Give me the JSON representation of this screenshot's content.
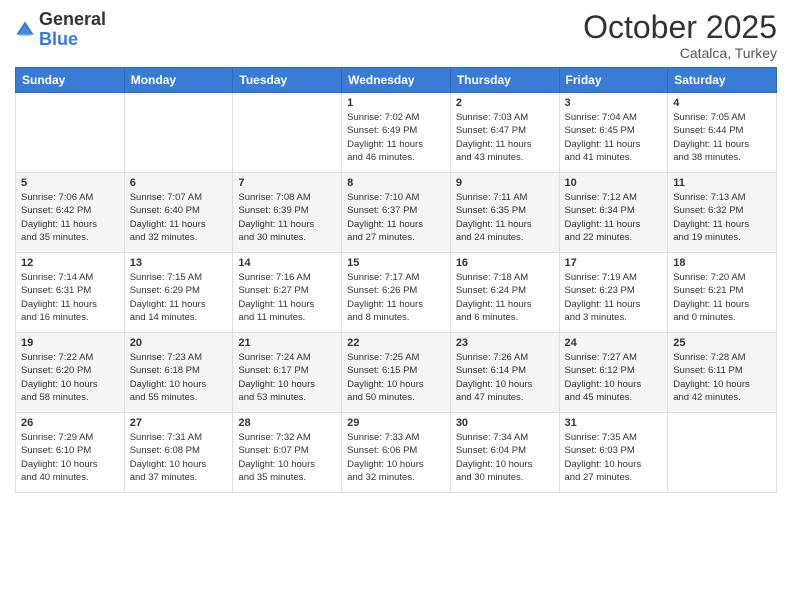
{
  "logo": {
    "text_general": "General",
    "text_blue": "Blue"
  },
  "header": {
    "month": "October 2025",
    "location": "Catalca, Turkey"
  },
  "weekdays": [
    "Sunday",
    "Monday",
    "Tuesday",
    "Wednesday",
    "Thursday",
    "Friday",
    "Saturday"
  ],
  "weeks": [
    [
      {
        "day": "",
        "info": ""
      },
      {
        "day": "",
        "info": ""
      },
      {
        "day": "",
        "info": ""
      },
      {
        "day": "1",
        "info": "Sunrise: 7:02 AM\nSunset: 6:49 PM\nDaylight: 11 hours\nand 46 minutes."
      },
      {
        "day": "2",
        "info": "Sunrise: 7:03 AM\nSunset: 6:47 PM\nDaylight: 11 hours\nand 43 minutes."
      },
      {
        "day": "3",
        "info": "Sunrise: 7:04 AM\nSunset: 6:45 PM\nDaylight: 11 hours\nand 41 minutes."
      },
      {
        "day": "4",
        "info": "Sunrise: 7:05 AM\nSunset: 6:44 PM\nDaylight: 11 hours\nand 38 minutes."
      }
    ],
    [
      {
        "day": "5",
        "info": "Sunrise: 7:06 AM\nSunset: 6:42 PM\nDaylight: 11 hours\nand 35 minutes."
      },
      {
        "day": "6",
        "info": "Sunrise: 7:07 AM\nSunset: 6:40 PM\nDaylight: 11 hours\nand 32 minutes."
      },
      {
        "day": "7",
        "info": "Sunrise: 7:08 AM\nSunset: 6:39 PM\nDaylight: 11 hours\nand 30 minutes."
      },
      {
        "day": "8",
        "info": "Sunrise: 7:10 AM\nSunset: 6:37 PM\nDaylight: 11 hours\nand 27 minutes."
      },
      {
        "day": "9",
        "info": "Sunrise: 7:11 AM\nSunset: 6:35 PM\nDaylight: 11 hours\nand 24 minutes."
      },
      {
        "day": "10",
        "info": "Sunrise: 7:12 AM\nSunset: 6:34 PM\nDaylight: 11 hours\nand 22 minutes."
      },
      {
        "day": "11",
        "info": "Sunrise: 7:13 AM\nSunset: 6:32 PM\nDaylight: 11 hours\nand 19 minutes."
      }
    ],
    [
      {
        "day": "12",
        "info": "Sunrise: 7:14 AM\nSunset: 6:31 PM\nDaylight: 11 hours\nand 16 minutes."
      },
      {
        "day": "13",
        "info": "Sunrise: 7:15 AM\nSunset: 6:29 PM\nDaylight: 11 hours\nand 14 minutes."
      },
      {
        "day": "14",
        "info": "Sunrise: 7:16 AM\nSunset: 6:27 PM\nDaylight: 11 hours\nand 11 minutes."
      },
      {
        "day": "15",
        "info": "Sunrise: 7:17 AM\nSunset: 6:26 PM\nDaylight: 11 hours\nand 8 minutes."
      },
      {
        "day": "16",
        "info": "Sunrise: 7:18 AM\nSunset: 6:24 PM\nDaylight: 11 hours\nand 6 minutes."
      },
      {
        "day": "17",
        "info": "Sunrise: 7:19 AM\nSunset: 6:23 PM\nDaylight: 11 hours\nand 3 minutes."
      },
      {
        "day": "18",
        "info": "Sunrise: 7:20 AM\nSunset: 6:21 PM\nDaylight: 11 hours\nand 0 minutes."
      }
    ],
    [
      {
        "day": "19",
        "info": "Sunrise: 7:22 AM\nSunset: 6:20 PM\nDaylight: 10 hours\nand 58 minutes."
      },
      {
        "day": "20",
        "info": "Sunrise: 7:23 AM\nSunset: 6:18 PM\nDaylight: 10 hours\nand 55 minutes."
      },
      {
        "day": "21",
        "info": "Sunrise: 7:24 AM\nSunset: 6:17 PM\nDaylight: 10 hours\nand 53 minutes."
      },
      {
        "day": "22",
        "info": "Sunrise: 7:25 AM\nSunset: 6:15 PM\nDaylight: 10 hours\nand 50 minutes."
      },
      {
        "day": "23",
        "info": "Sunrise: 7:26 AM\nSunset: 6:14 PM\nDaylight: 10 hours\nand 47 minutes."
      },
      {
        "day": "24",
        "info": "Sunrise: 7:27 AM\nSunset: 6:12 PM\nDaylight: 10 hours\nand 45 minutes."
      },
      {
        "day": "25",
        "info": "Sunrise: 7:28 AM\nSunset: 6:11 PM\nDaylight: 10 hours\nand 42 minutes."
      }
    ],
    [
      {
        "day": "26",
        "info": "Sunrise: 7:29 AM\nSunset: 6:10 PM\nDaylight: 10 hours\nand 40 minutes."
      },
      {
        "day": "27",
        "info": "Sunrise: 7:31 AM\nSunset: 6:08 PM\nDaylight: 10 hours\nand 37 minutes."
      },
      {
        "day": "28",
        "info": "Sunrise: 7:32 AM\nSunset: 6:07 PM\nDaylight: 10 hours\nand 35 minutes."
      },
      {
        "day": "29",
        "info": "Sunrise: 7:33 AM\nSunset: 6:06 PM\nDaylight: 10 hours\nand 32 minutes."
      },
      {
        "day": "30",
        "info": "Sunrise: 7:34 AM\nSunset: 6:04 PM\nDaylight: 10 hours\nand 30 minutes."
      },
      {
        "day": "31",
        "info": "Sunrise: 7:35 AM\nSunset: 6:03 PM\nDaylight: 10 hours\nand 27 minutes."
      },
      {
        "day": "",
        "info": ""
      }
    ]
  ]
}
